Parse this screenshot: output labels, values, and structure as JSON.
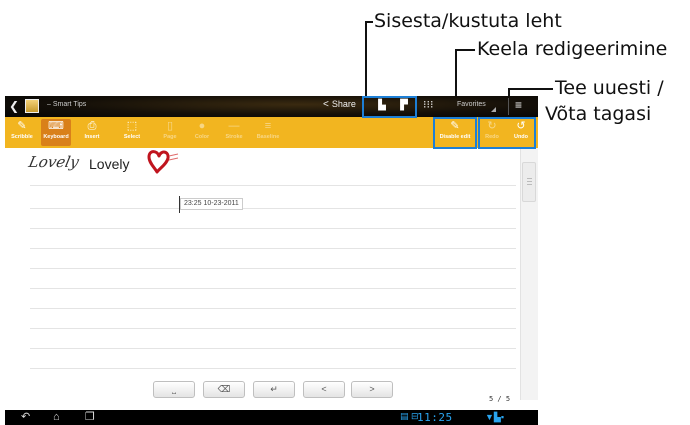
{
  "callouts": {
    "insert_delete": "Sisesta/kustuta leht",
    "disable_edit": "Keela redigeerimine",
    "redo_undo_line1": "Tee uuesti /",
    "redo_undo_line2": "Võta tagasi"
  },
  "actionbar": {
    "back_icon": "back-arrow-icon",
    "title": "– Smart Tips",
    "share_label": "Share",
    "insert_page_icon": "insert-page-icon",
    "delete_page_icon": "delete-page-icon",
    "grid_icon": "grid-icon",
    "favorites_label": "Favorites",
    "menu_icon": "menu-icon"
  },
  "toolbar": {
    "tools": [
      {
        "label": "Scribble",
        "icon": "scribble-icon",
        "glyph": "✎"
      },
      {
        "label": "Keyboard",
        "icon": "keyboard-icon",
        "glyph": "⌨"
      },
      {
        "label": "Insert",
        "icon": "insert-icon",
        "glyph": "⎙"
      },
      {
        "label": "Select",
        "icon": "select-icon",
        "glyph": "⬚"
      },
      {
        "label": "Page",
        "icon": "page-icon",
        "glyph": "▯"
      },
      {
        "label": "Color",
        "icon": "color-dot-icon",
        "glyph": "●"
      },
      {
        "label": "Stroke",
        "icon": "stroke-icon",
        "glyph": "—"
      },
      {
        "label": "Baseline",
        "icon": "baseline-icon",
        "glyph": "≡"
      }
    ],
    "disable_edit_label": "Disable edit",
    "redo_label": "Redo",
    "undo_label": "Undo"
  },
  "note": {
    "handwritten_word": "Lovely",
    "typed_word": "Lovely",
    "timestamp": "23:25 10-23-2011"
  },
  "keyboard_row": {
    "space_glyph": "⎵",
    "backspace_glyph": "⌫",
    "enter_glyph": "↵",
    "left_glyph": "<",
    "right_glyph": ">"
  },
  "page_indicator": "5 / 5",
  "sysbar": {
    "back_glyph": "↶",
    "home_glyph": "⌂",
    "recent_glyph": "❐",
    "clock": "11:25"
  },
  "colors": {
    "toolbar": "#f2b520",
    "highlight_box": "#1d7fd6",
    "heart": "#c0141e",
    "status_blue": "#29a4ef"
  }
}
